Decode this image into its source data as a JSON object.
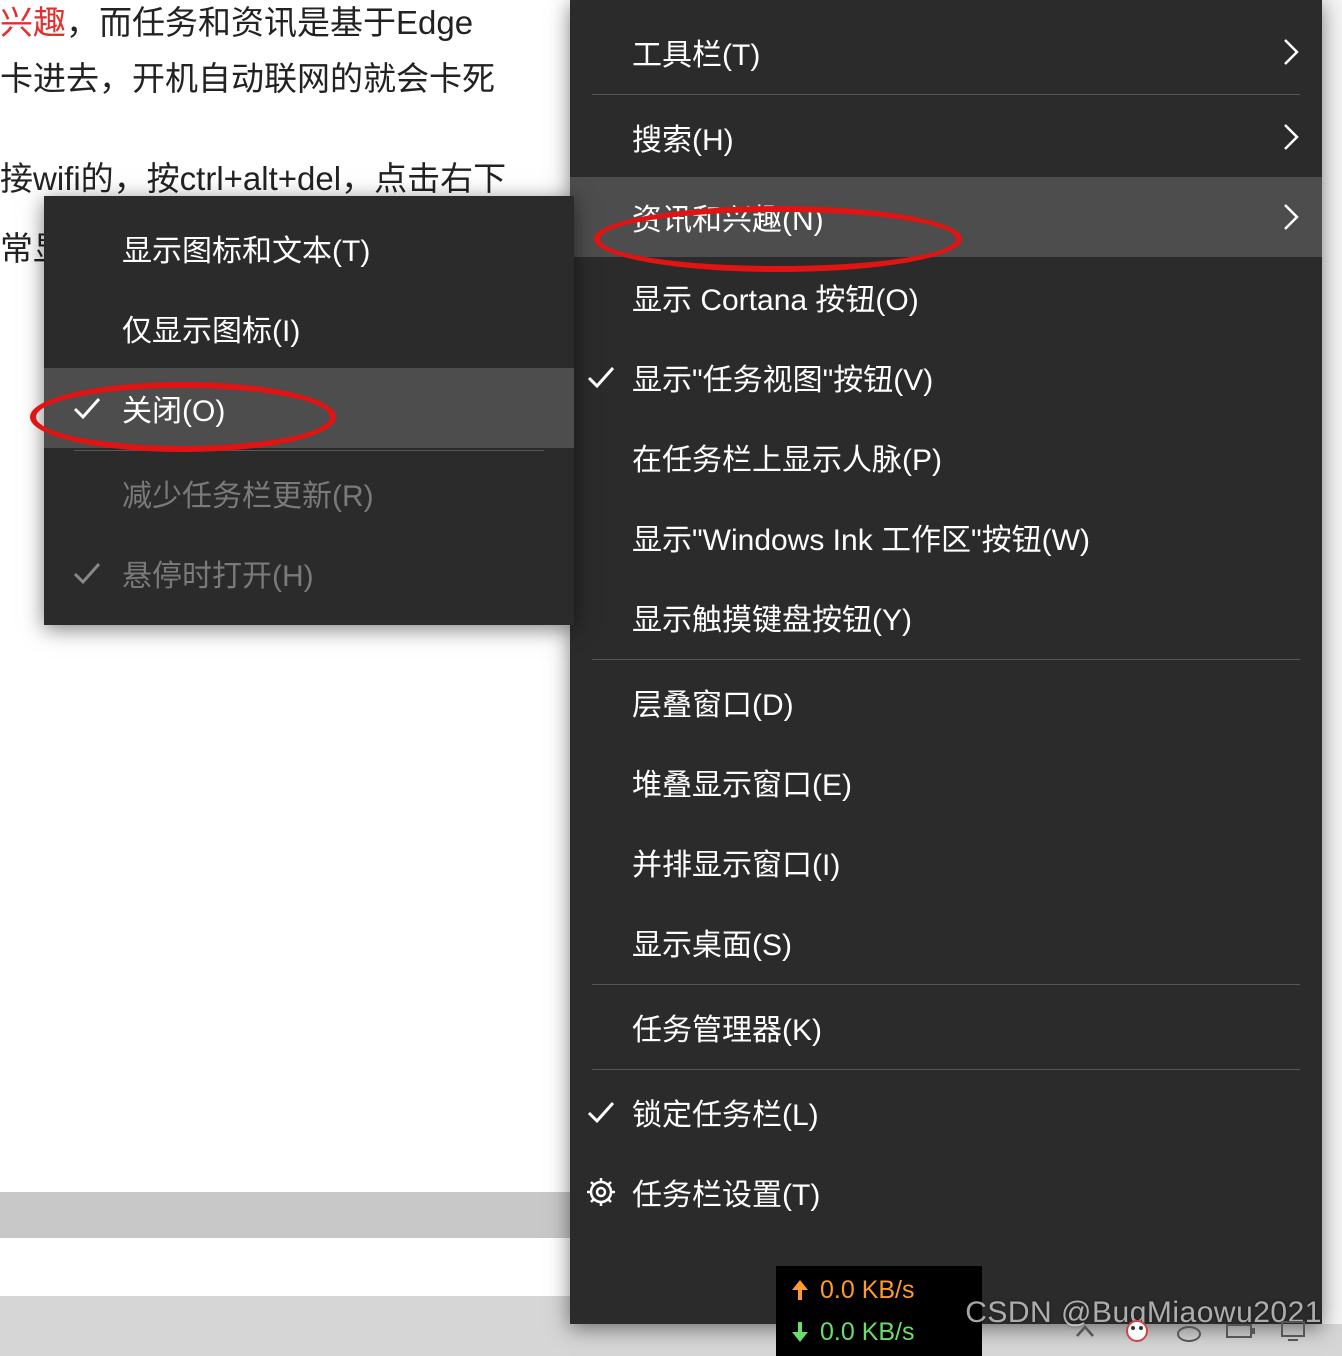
{
  "background_text": {
    "line1_hl": "兴趣",
    "line1_rest": "，而任务和资讯是基于Edge",
    "line2": "卡进去，开机自动联网的就会卡死",
    "line3": "接wifi的，按ctrl+alt+del，点击右下",
    "line4": "常显"
  },
  "submenu": {
    "items": [
      {
        "label": "显示图标和文本(T)",
        "checked": false,
        "disabled": false
      },
      {
        "label": "仅显示图标(I)",
        "checked": false,
        "disabled": false
      },
      {
        "label": "关闭(O)",
        "checked": true,
        "disabled": false,
        "hover": true,
        "circled": true
      }
    ],
    "items2": [
      {
        "label": "减少任务栏更新(R)",
        "checked": false,
        "disabled": true
      },
      {
        "label": "悬停时打开(H)",
        "checked": true,
        "disabled": true
      }
    ]
  },
  "main_menu": {
    "group1": [
      {
        "label": "工具栏(T)",
        "submenu": true
      },
      {
        "label": "搜索(H)",
        "submenu": true
      },
      {
        "label": "资讯和兴趣(N)",
        "submenu": true,
        "hover": true,
        "circled": true
      },
      {
        "label": "显示 Cortana 按钮(O)"
      },
      {
        "label": "显示\"任务视图\"按钮(V)",
        "checked": true
      },
      {
        "label": "在任务栏上显示人脉(P)"
      },
      {
        "label": "显示\"Windows Ink 工作区\"按钮(W)"
      },
      {
        "label": "显示触摸键盘按钮(Y)"
      }
    ],
    "group2": [
      {
        "label": "层叠窗口(D)"
      },
      {
        "label": "堆叠显示窗口(E)"
      },
      {
        "label": "并排显示窗口(I)"
      },
      {
        "label": "显示桌面(S)"
      }
    ],
    "group3": [
      {
        "label": "任务管理器(K)"
      }
    ],
    "group4": [
      {
        "label": "锁定任务栏(L)",
        "checked": true
      },
      {
        "label": "任务栏设置(T)",
        "gear": true
      }
    ]
  },
  "netspeed": {
    "up": "0.0 KB/s",
    "down": "0.0 KB/s"
  },
  "watermark": "CSDN @BugMiaowu2021",
  "colors": {
    "menu_bg": "#2b2b2b",
    "menu_hover": "#4d4d4d",
    "highlight_red": "#e11313"
  }
}
